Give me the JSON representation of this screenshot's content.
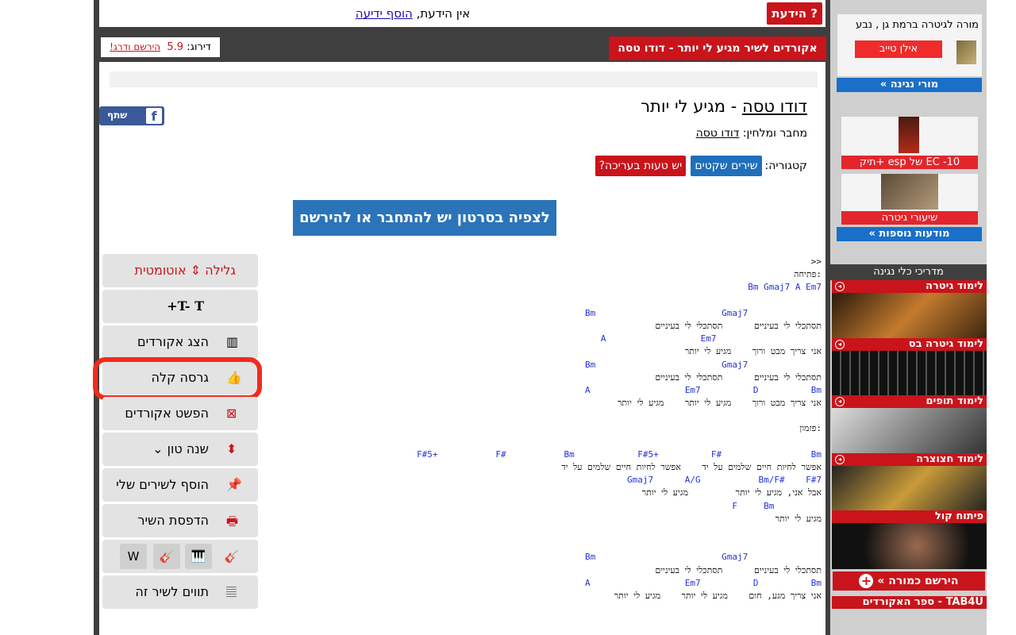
{
  "notice": {
    "news_button": "הידעת ?",
    "message_prefix": "אין הידעת,",
    "message_link": "הוסף ידיעה"
  },
  "header": {
    "title_bar": "אקורדים לשיר מגיע לי יותר - דודו טסה",
    "rating_label": "דירוג:",
    "rating_value": "5.9",
    "rating_link": "הירשם ודרג!"
  },
  "song": {
    "artist": "דודו טסה",
    "separator": "-",
    "title": "מגיע לי יותר",
    "composer_label": "מחבר ומלחין:",
    "composer": "דודו טסה",
    "category_label": "קטגוריה:",
    "category": "שירים שקטים",
    "error_button": "יש טעות בעריכה?",
    "share_label": "שתף",
    "video_button": "לצפיה בסרטון יש להתחבר או להירשם"
  },
  "sheet": {
    "lines": [
      {
        "t": "ly",
        "text": ">>"
      },
      {
        "t": "ly",
        "text": "פתיחה:"
      },
      {
        "t": "ch",
        "text": "Bm Gmaj7 A Em7"
      },
      {
        "t": "ly",
        "text": " "
      },
      {
        "t": "ch",
        "text": "Bm                        Gmaj7              "
      },
      {
        "t": "ly",
        "text": "תסתכלי לי בעיניים      תסתכלי לי בעיניים"
      },
      {
        "t": "ch",
        "text": "A                  Em7                    "
      },
      {
        "t": "ly",
        "text": "אני צריך מבט ורוך    מגיע לי יותר"
      },
      {
        "t": "ch",
        "text": "Bm                        Gmaj7              "
      },
      {
        "t": "ly",
        "text": "תסתכלי לי בעיניים      תסתכלי לי בעיניים"
      },
      {
        "t": "ch",
        "text": "A                  Em7          D          Bm"
      },
      {
        "t": "ly",
        "text": "אני צריך מבט ורוך    מגיע לי יותר    מגיע לי יותר"
      },
      {
        "t": "ly",
        "text": " "
      },
      {
        "t": "ly",
        "text": "פזמון:"
      },
      {
        "t": "ly",
        "text": " "
      },
      {
        "t": "ch",
        "text": "F#5+           F#           Bm            F#5+          F#                 Bm"
      },
      {
        "t": "ly",
        "text": "אפשר לחיות חיים שלמים על יד    אפשר לחיות חיים שלמים על יד"
      },
      {
        "t": "ch",
        "text": "Gmaj7      A/G           Bm/F#    F#7"
      },
      {
        "t": "ly",
        "text": "אבל אני, מגיע לי יותר         מגיע לי יותר"
      },
      {
        "t": "ch",
        "text": "F     Bm         "
      },
      {
        "t": "ly",
        "text": "מגיע לי יותר"
      },
      {
        "t": "ly",
        "text": " "
      },
      {
        "t": "ly",
        "text": " "
      },
      {
        "t": "ch",
        "text": "Bm                        Gmaj7              "
      },
      {
        "t": "ly",
        "text": "תסתכלי לי בעיניים      תסתכלי לי בעיניים"
      },
      {
        "t": "ch",
        "text": "A                  Em7          D          Bm"
      },
      {
        "t": "ly",
        "text": "אני צריך מגע, חום    מגיע לי יותר    מגיע לי יותר"
      }
    ]
  },
  "tools": {
    "autoscroll": "גלילה ⇕ אוטומטית",
    "font_size": "T- T+",
    "show_chords": "הצג אקורדים",
    "easy_version": "גרסה קלה",
    "simplify_chords": "הפשט אקורדים",
    "change_key": "שנה טון ⌄",
    "add_to_my_songs": "הוסף לשירים שלי",
    "print_song": "הדפסת השיר",
    "notes_for_song": "תווים לשיר זה"
  },
  "sidebar": {
    "teacher_text": "מורה לגיטרה ברמת גן , נבע",
    "teacher_button": "אילן טייב",
    "teachers_link": "מורי נגינה »",
    "promo1": "EC -10 של esp +תיק",
    "promo2": "שיעורי גיטרה",
    "more_ads": "מודעות נוספות »",
    "guides_title": "מדריכי כלי נגינה",
    "lessons": [
      "לימוד גיטרה",
      "לימוד גיטרה בס",
      "לימוד תופים",
      "לימוד חצוצרה",
      "פיתוח קול"
    ],
    "register_teacher": "הירשם כמורה »",
    "chord_book": "TAB4U - ספר האקורדים"
  },
  "colors": {
    "accent_red": "#c9141b",
    "chord_blue": "#2431d6",
    "link_blue": "#1f6fba",
    "highlight": "#f22b1d"
  }
}
